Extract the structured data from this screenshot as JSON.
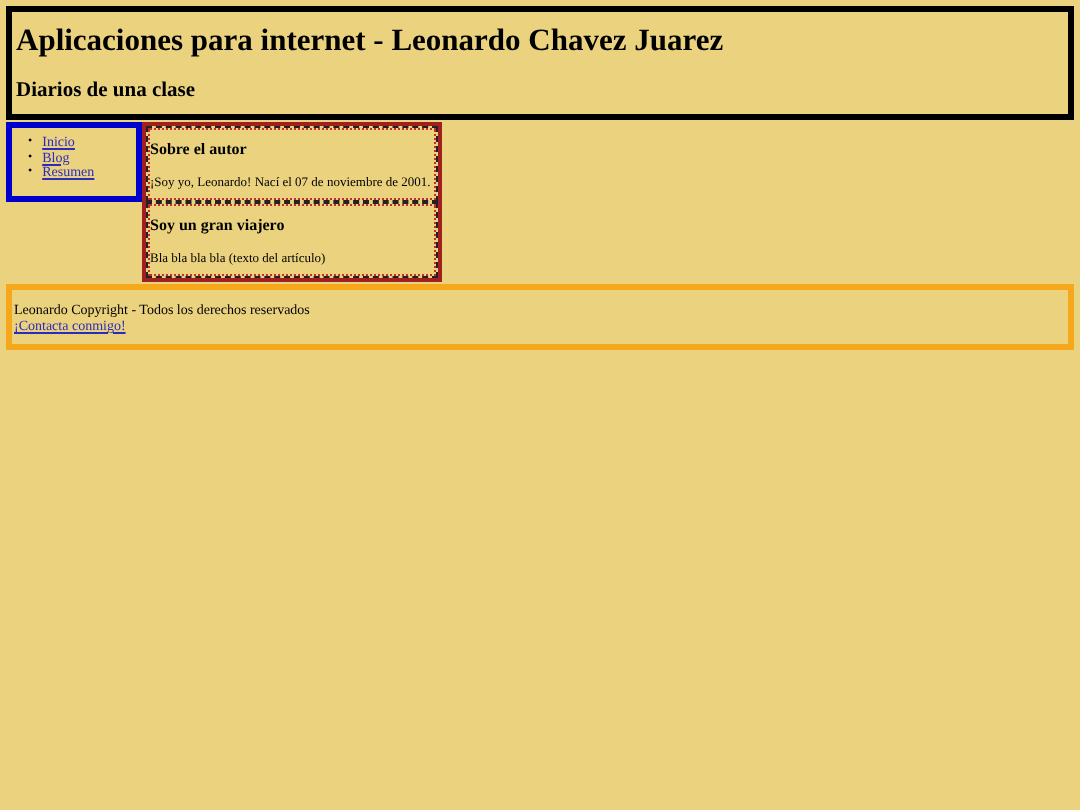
{
  "header": {
    "title": "Aplicaciones para internet - Leonardo Chavez Juarez",
    "subtitle": "Diarios de una clase"
  },
  "nav": {
    "items": [
      {
        "marker": "•",
        "label": "Inicio"
      },
      {
        "marker": "•",
        "label": "Blog"
      },
      {
        "marker": "•",
        "label": "Resumen"
      }
    ]
  },
  "articles": [
    {
      "title": "Sobre el autor",
      "text": "¡Soy yo, Leonardo! Nací el 07 de noviembre de 2001."
    },
    {
      "title": "Soy un gran viajero",
      "text": "Bla bla bla bla (texto del artículo)"
    }
  ],
  "footer": {
    "text": "Leonardo Copyright - Todos los derechos reservados",
    "link": "¡Contacta conmigo!"
  }
}
